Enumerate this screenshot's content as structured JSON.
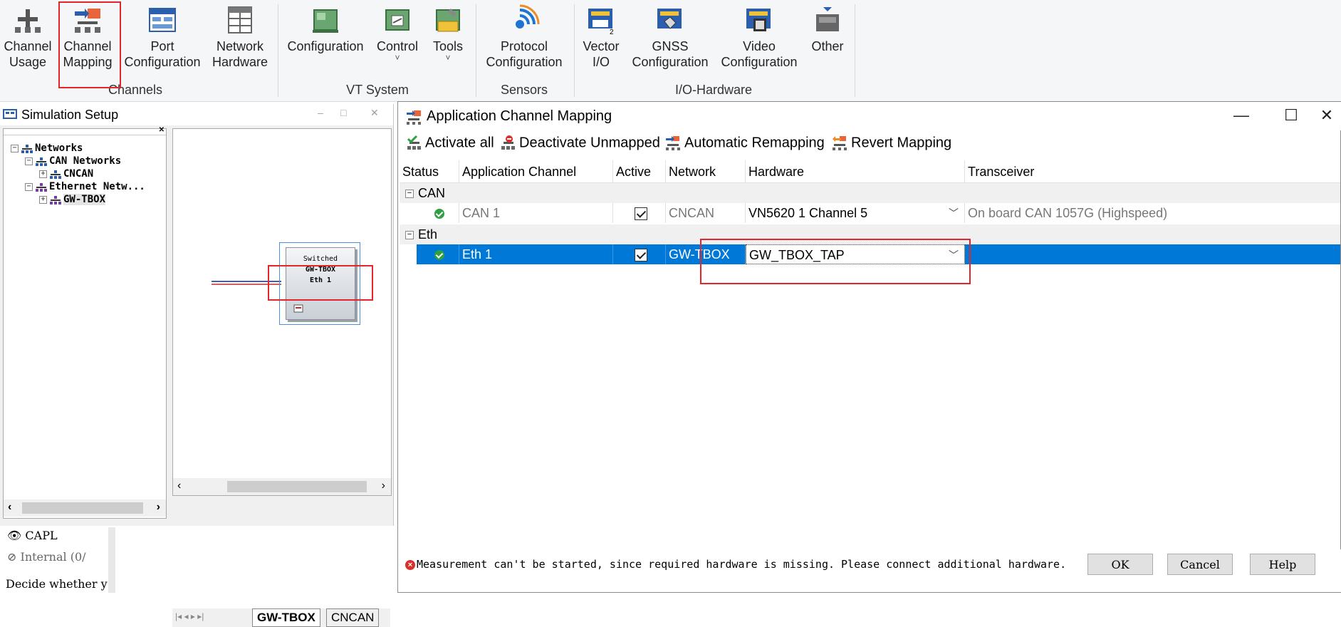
{
  "ribbon": {
    "buttons": [
      {
        "label": "Channel\nUsage"
      },
      {
        "label": "Channel\nMapping"
      },
      {
        "label": "Port\nConfiguration"
      },
      {
        "label": "Network\nHardware"
      },
      {
        "label": "Configuration"
      },
      {
        "label": "Control"
      },
      {
        "label": "Tools"
      },
      {
        "label": "Protocol\nConfiguration"
      },
      {
        "label": "Vector\nI/O"
      },
      {
        "label": "GNSS\nConfiguration"
      },
      {
        "label": "Video\nConfiguration"
      },
      {
        "label": "Other"
      }
    ],
    "groups": [
      "Channels",
      "VT System",
      "Sensors",
      "I/O-Hardware"
    ]
  },
  "simulation_setup": {
    "title": "Simulation Setup",
    "window_controls": [
      "–",
      "□",
      "✕"
    ],
    "tree": [
      {
        "label": "Networks",
        "expander": "−"
      },
      {
        "label": "CAN Networks",
        "expander": "−"
      },
      {
        "label": "CNCAN",
        "expander": "+"
      },
      {
        "label": "Ethernet Netw...",
        "expander": "−"
      },
      {
        "label": "GW-TBOX",
        "expander": "+"
      }
    ],
    "switch_block": {
      "line1": "Switched",
      "line2": "GW-TBOX",
      "line3": "Eth 1"
    },
    "sheet_tabs": [
      "GW-TBOX",
      "CNCAN"
    ]
  },
  "bottom_panel": {
    "items": [
      "CAPL",
      "Internal (0/",
      "Decide whether y"
    ]
  },
  "dialog": {
    "title": "Application Channel Mapping",
    "toolbar": {
      "activate_all": "Activate all",
      "deactivate_unmapped": "Deactivate Unmapped",
      "automatic_remapping": "Automatic Remapping",
      "revert_mapping": "Revert Mapping"
    },
    "columns": [
      "Status",
      "Application Channel",
      "Active",
      "Network",
      "Hardware",
      "Transceiver"
    ],
    "groups": [
      {
        "name": "CAN",
        "rows": [
          {
            "channel": "CAN 1",
            "active": true,
            "network": "CNCAN",
            "hardware": "VN5620 1 Channel 5",
            "transceiver": "On board CAN 1057G (Highspeed)"
          }
        ]
      },
      {
        "name": "Eth",
        "rows": [
          {
            "channel": "Eth 1",
            "active": true,
            "network": "GW-TBOX",
            "hardware": "GW_TBOX_TAP",
            "transceiver": ""
          }
        ]
      }
    ],
    "message": "Measurement can't be started, since required hardware is missing. Please connect additional hardware.",
    "buttons": {
      "ok": "OK",
      "cancel": "Cancel",
      "help": "Help"
    }
  },
  "colors": {
    "selection": "#0078d7",
    "highlight": "#e3262c",
    "ok_status": "#2ea043",
    "error": "#d9302c"
  }
}
